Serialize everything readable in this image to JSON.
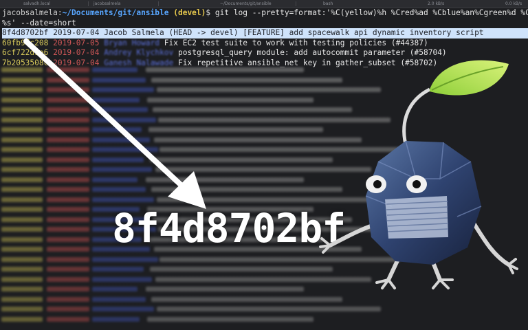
{
  "window": {
    "tabs": [
      "salvadh.local",
      "jacobsalmela",
      "~/Documents/git/ansible",
      "bash"
    ],
    "net_in": "2.0 kB/s",
    "net_out": "0.0 kB/s"
  },
  "terminal": {
    "prompt_user": "jacobsalmela:",
    "prompt_path": "~/Documents/git/ansible",
    "prompt_branch": "(devel)",
    "command_line1": "$ git log --pretty=format:'%C(yellow)%h %Cred%ad %Cblue%an%Cgreen%d %Creset",
    "command_line2": "%s' --date=short",
    "rows": [
      {
        "hash": "8f4d8702bf",
        "date": "2019-07-04",
        "author": "Jacob Salmela",
        "refs": " (HEAD -> devel)",
        "msg": " [FEATURE] add spacewalk api dynamic inventory script"
      },
      {
        "hash": "60fb9fc208",
        "date": "2019-07-05",
        "author": "Bryan Howard",
        "refs": "",
        "msg": "Fix EC2 test suite to work with testing policies (#44387)"
      },
      {
        "hash": "6cf722d9e6",
        "date": "2019-07-04",
        "author": "Andrey Klychkov",
        "refs": "",
        "msg": "postgresql_query module: add autocommit parameter (#58704)"
      },
      {
        "hash": "7b2053508c",
        "date": "2019-07-04",
        "author": "Ganesh Nalawade",
        "refs": "",
        "msg": "Fix repetitive ansible_net key in gather_subset (#58702)"
      }
    ]
  },
  "overlay": {
    "big_hash": "8f4d8702bf"
  },
  "colors": {
    "background": "#1d1e21",
    "hash": "#d7c95a",
    "date": "#d25858",
    "author": "#5b6fd8",
    "path": "#58a6ff",
    "highlight": "#cfe3fb"
  }
}
